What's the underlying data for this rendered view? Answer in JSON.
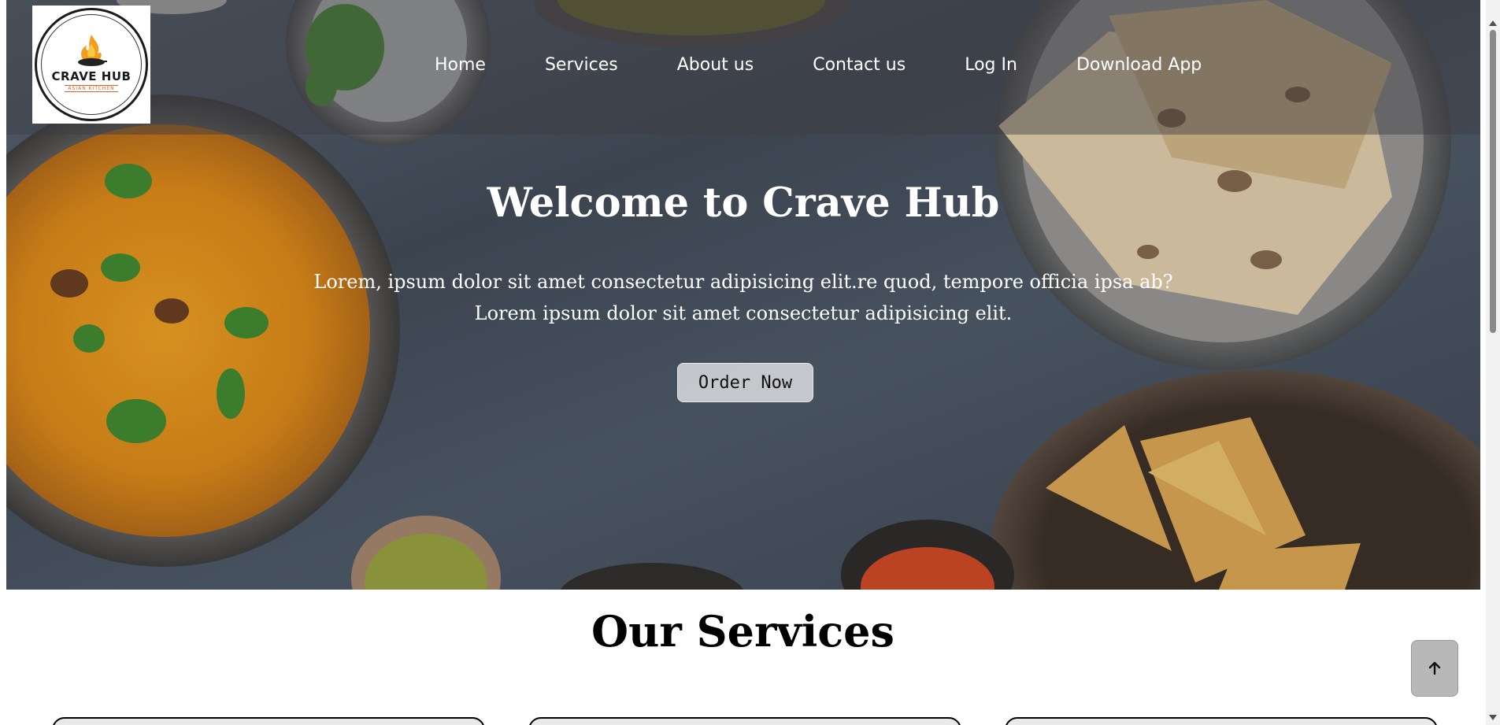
{
  "brand": {
    "name": "CRAVE HUB",
    "tagline": "ASIAN KITCHEN"
  },
  "nav": {
    "items": [
      {
        "label": "Home"
      },
      {
        "label": "Services"
      },
      {
        "label": "About us"
      },
      {
        "label": "Contact us"
      },
      {
        "label": "Log In"
      },
      {
        "label": "Download App"
      }
    ]
  },
  "hero": {
    "title": "Welcome to Crave Hub",
    "line1": "Lorem, ipsum dolor sit amet consectetur adipisicing elit.re quod, tempore officia ipsa ab?",
    "line2": "Lorem ipsum dolor sit amet consectetur adipisicing elit.",
    "button": "Order Now"
  },
  "services": {
    "title": "Our Services"
  },
  "back_to_top": {
    "icon": "arrow-up-icon",
    "glyph": "🡡"
  },
  "colors": {
    "accent": "#d9652b",
    "hero_bg": "#4a5562"
  }
}
